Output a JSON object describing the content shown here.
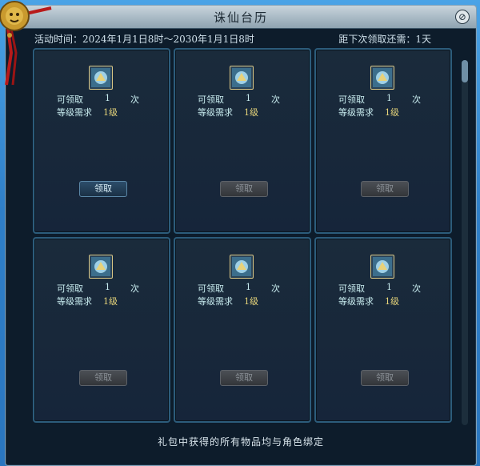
{
  "window": {
    "title": "诛仙台历"
  },
  "info": {
    "activity_time": "活动时间：2024年1月1日8时～2030年1月1日8时",
    "next_claim": "距下次领取还需：1天"
  },
  "cards": [
    {
      "claimable_label": "可领取",
      "claimable_count": "1",
      "claimable_unit": "次",
      "level_label": "等级需求",
      "level_value": "1级",
      "button_label": "领取",
      "button_enabled": true
    },
    {
      "claimable_label": "可领取",
      "claimable_count": "1",
      "claimable_unit": "次",
      "level_label": "等级需求",
      "level_value": "1级",
      "button_label": "领取",
      "button_enabled": false
    },
    {
      "claimable_label": "可领取",
      "claimable_count": "1",
      "claimable_unit": "次",
      "level_label": "等级需求",
      "level_value": "1级",
      "button_label": "领取",
      "button_enabled": false
    },
    {
      "claimable_label": "可领取",
      "claimable_count": "1",
      "claimable_unit": "次",
      "level_label": "等级需求",
      "level_value": "1级",
      "button_label": "领取",
      "button_enabled": false
    },
    {
      "claimable_label": "可领取",
      "claimable_count": "1",
      "claimable_unit": "次",
      "level_label": "等级需求",
      "level_value": "1级",
      "button_label": "领取",
      "button_enabled": false
    },
    {
      "claimable_label": "可领取",
      "claimable_count": "1",
      "claimable_unit": "次",
      "level_label": "等级需求",
      "level_value": "1级",
      "button_label": "领取",
      "button_enabled": false
    }
  ],
  "footer": {
    "note": "礼包中获得的所有物品均与角色绑定"
  },
  "colors": {
    "panel_bg": "#0d1c2b",
    "card_border": "#2c5c7b",
    "text_cyan": "#c8ecef",
    "text_gold": "#e6d47a"
  },
  "icons": {
    "close": "close-icon",
    "gift": "gift-package-icon",
    "ornament": "lion-head-tassel-ornament"
  }
}
